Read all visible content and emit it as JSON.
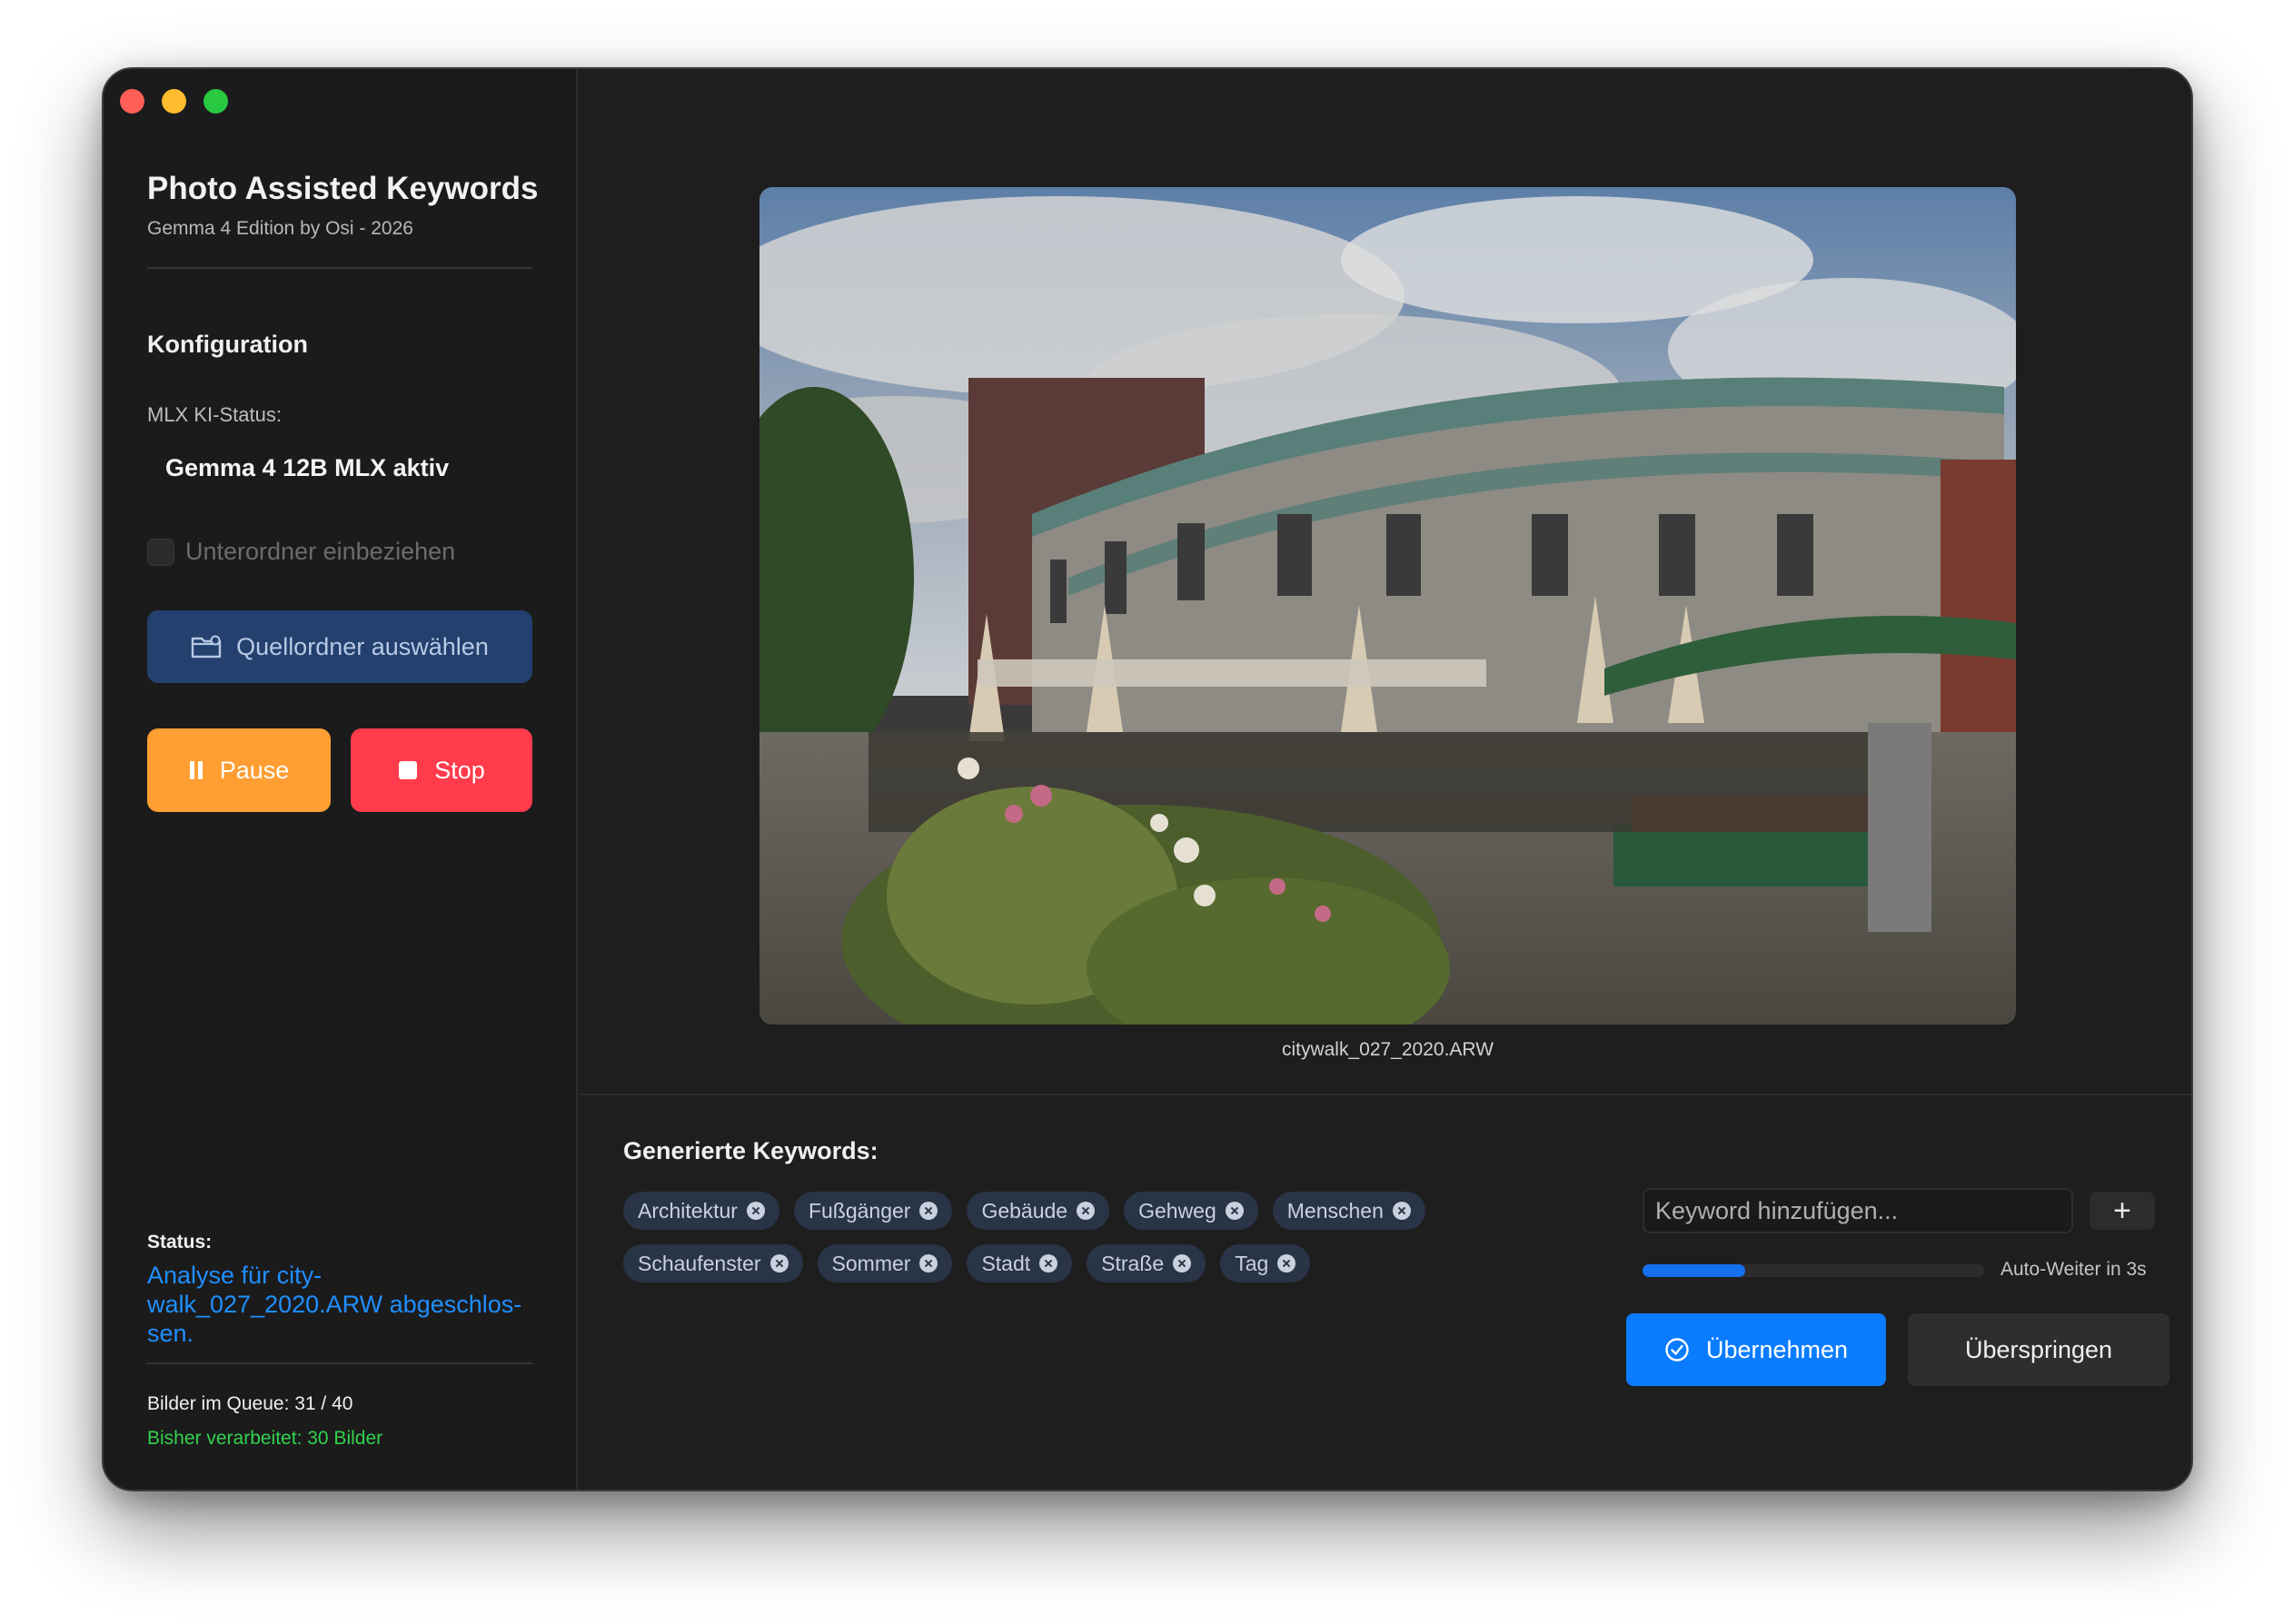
{
  "app": {
    "title": "Photo Assisted Keywords",
    "subtitle": "Gemma 4 Edition by Osi - 2026"
  },
  "config": {
    "section_title": "Konfiguration",
    "mlx_label": "MLX KI-Status:",
    "mlx_value": "Gemma 4 12B MLX aktiv",
    "subfolder_label": "Unterordner einbeziehen",
    "subfolder_checked": false,
    "source_button": "Quellordner auswählen",
    "pause_button": "Pause",
    "stop_button": "Stop"
  },
  "status": {
    "label": "Status:",
    "message": "Analyse für city-walk_027_2020.ARW abgeschlos-sen.",
    "queue": "Bilder im Queue: 31 / 40",
    "processed": "Bisher verarbeitet: 30 Bilder"
  },
  "preview": {
    "filename": "citywalk_027_2020.ARW"
  },
  "keywords": {
    "title": "Generierte Keywords:",
    "items": [
      "Architektur",
      "Fußgänger",
      "Gebäude",
      "Gehweg",
      "Menschen",
      "Schaufenster",
      "Sommer",
      "Stadt",
      "Straße",
      "Tag"
    ],
    "input_placeholder": "Keyword hinzufügen...",
    "add_button": "+"
  },
  "auto_advance": {
    "label": "Auto-Weiter in 3s",
    "progress": 0.3
  },
  "actions": {
    "accept": "Übernehmen",
    "skip": "Überspringen"
  },
  "colors": {
    "accent_blue": "#0a7cff",
    "pause_orange": "#ff9e33",
    "stop_red": "#ff3b4c",
    "status_blue": "#1f8fff",
    "processed_green": "#33d24e"
  }
}
